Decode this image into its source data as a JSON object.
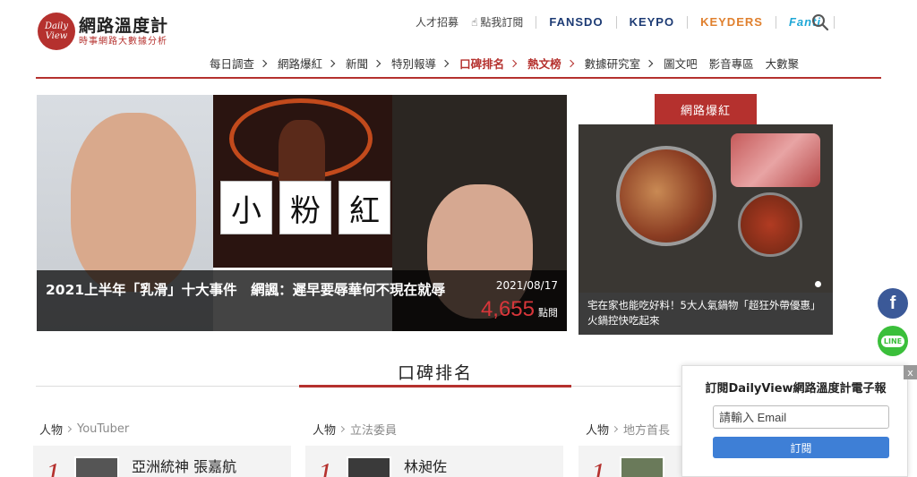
{
  "logo": {
    "circle_top": "Daily",
    "circle_bottom": "View",
    "title": "網路溫度計",
    "subtitle": "時事網路大數據分析"
  },
  "topbar": {
    "links": [
      "人才招募",
      "點我訂閱"
    ],
    "brands": [
      {
        "label": "FANSDO",
        "color": "#1d3b74"
      },
      {
        "label": "KEYPO",
        "color": "#1d3b74"
      },
      {
        "label": "KEYDERS",
        "color": "#e0802e"
      },
      {
        "label": "Fanti",
        "color": "#1fa7d6"
      }
    ]
  },
  "nav": [
    {
      "label": "每日調查",
      "chevron": true,
      "red": false
    },
    {
      "label": "網路爆紅",
      "chevron": true,
      "red": false
    },
    {
      "label": "新聞",
      "chevron": true,
      "red": false
    },
    {
      "label": "特別報導",
      "chevron": true,
      "red": false
    },
    {
      "label": "口碑排名",
      "chevron": true,
      "red": true
    },
    {
      "label": "熱文榜",
      "chevron": true,
      "red": true
    },
    {
      "label": "數據研究室",
      "chevron": true,
      "red": false
    },
    {
      "label": "圖文吧",
      "chevron": false,
      "red": false
    },
    {
      "label": "影音專區",
      "chevron": false,
      "red": false
    },
    {
      "label": "大數聚",
      "chevron": false,
      "red": false
    }
  ],
  "hero": {
    "title": "2021上半年「乳滑」十大事件　網諷：遲早要辱華何不現在就辱",
    "date": "2021/08/17",
    "views": "4,655",
    "views_unit": "點閱",
    "chars": [
      "小",
      "粉",
      "紅"
    ]
  },
  "side": {
    "tag": "網路爆紅",
    "caption": "宅在家也能吃好料！5大人氣鍋物「超狂外帶優惠」　火鍋控快吃起來"
  },
  "ranking": {
    "title": "口碑排名",
    "cards": [
      {
        "category": "人物",
        "sub": "YouTuber",
        "rank": "1",
        "name": "亞洲統神 張嘉航"
      },
      {
        "category": "人物",
        "sub": "立法委員",
        "rank": "1",
        "name": "林昶佐"
      },
      {
        "category": "人物",
        "sub": "地方首長",
        "rank": "1",
        "name": ""
      }
    ]
  },
  "social": {
    "facebook": "f",
    "line": "LINE"
  },
  "newsletter": {
    "title": "訂閱DailyView網路溫度計電子報",
    "placeholder": "請輸入 Email",
    "button": "訂閱",
    "close": "x"
  }
}
